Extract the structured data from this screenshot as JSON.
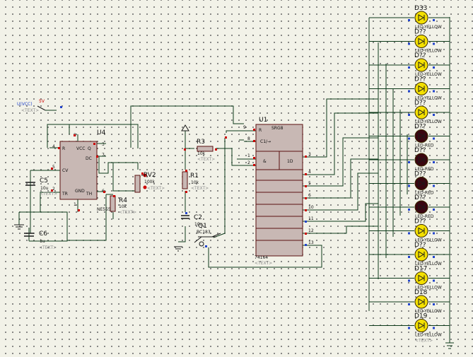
{
  "ic_u4": {
    "ref": "U4",
    "part": "NE555",
    "text": "<TEXT>",
    "pins": {
      "p4": "4",
      "p8": "8",
      "p3": "3",
      "p7": "7",
      "p5": "5",
      "p2": "2",
      "p6": "6",
      "p1": "1"
    },
    "pin_names": {
      "r": "R",
      "vcc": "VCC",
      "q": "Q",
      "dc": "DC",
      "cv": "CV",
      "tr": "TR",
      "gnd": "GND",
      "th": "TH"
    }
  },
  "ic_u1": {
    "ref": "U1",
    "header": "SRG8",
    "part": "74164",
    "text": "<TEXT>",
    "r_label": "R",
    "clk_label": "C1/→",
    "and_label": "&",
    "d_label": "1D",
    "inputs": [
      "9",
      "8",
      "1",
      "2"
    ],
    "outputs": [
      "3",
      "4",
      "5",
      "6",
      "10",
      "11",
      "12",
      "13"
    ]
  },
  "r1": {
    "ref": "R1",
    "value": "10k",
    "text": "<TEXT>"
  },
  "r3": {
    "ref": "R3",
    "value": "10k",
    "text": "<TEXT>"
  },
  "r4": {
    "ref": "R4",
    "value": "10k",
    "text": "<TEXT>"
  },
  "rv2": {
    "ref": "RV2",
    "value": "100k",
    "text": "<TEXT>"
  },
  "c5": {
    "ref": "C5",
    "value": "10u",
    "text": "<TEXT>"
  },
  "c6": {
    "ref": "C6",
    "value": "1u",
    "text": "<TEXT>"
  },
  "c2": {
    "ref": "C2",
    "value": "10u"
  },
  "q1": {
    "ref": "Q1",
    "part": "BC183",
    "text": "<TEXT>"
  },
  "power": {
    "label": "U(VCC)",
    "value": "5V",
    "text": "<TEXT>"
  },
  "leds": [
    {
      "ref": "D33",
      "type": "LED-YELLOW",
      "color": "#f4e000"
    },
    {
      "ref": "D??",
      "type": "LED-YELLOW",
      "color": "#f4e000"
    },
    {
      "ref": "D??",
      "type": "LED-YELLOW",
      "color": "#f4e000"
    },
    {
      "ref": "D??",
      "type": "LED-YELLOW",
      "color": "#f4e000"
    },
    {
      "ref": "D??",
      "type": "LED-YELLOW",
      "color": "#f4e000"
    },
    {
      "ref": "D??",
      "type": "LED-RED",
      "color": "#3a0510"
    },
    {
      "ref": "D??",
      "type": "LED-RED",
      "color": "#3a0510"
    },
    {
      "ref": "D??",
      "type": "LED-RED",
      "color": "#3a0510"
    },
    {
      "ref": "D??",
      "type": "LED-RED",
      "color": "#3a0510"
    },
    {
      "ref": "D??",
      "type": "LED-YELLOW",
      "color": "#f4e000"
    },
    {
      "ref": "D??",
      "type": "LED-YELLOW",
      "color": "#f4e000"
    },
    {
      "ref": "D17",
      "type": "LED-YELLOW",
      "color": "#f4e000"
    },
    {
      "ref": "D18",
      "type": "LED-YELLOW",
      "color": "#f4e000"
    },
    {
      "ref": "D19",
      "type": "LED-YELLOW",
      "color": "#f4e000"
    }
  ],
  "led_text": "<TEXT>",
  "colors": {
    "wire": "#0d3a1a",
    "ic_body": "#c8b8b4",
    "ic_border": "#5a1010",
    "pin_red": "#cc0000",
    "pin_blue": "#2244cc",
    "background": "#f2f2e8"
  }
}
